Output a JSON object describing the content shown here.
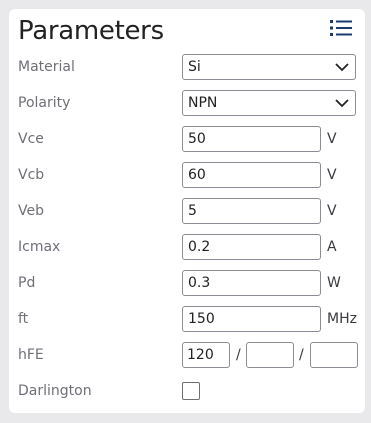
{
  "panel": {
    "title": "Parameters",
    "menu_icon": "list-icon"
  },
  "fields": {
    "material": {
      "label": "Material",
      "value": "Si"
    },
    "polarity": {
      "label": "Polarity",
      "value": "NPN"
    },
    "vce": {
      "label": "Vce",
      "value": "50",
      "unit": "V"
    },
    "vcb": {
      "label": "Vcb",
      "value": "60",
      "unit": "V"
    },
    "veb": {
      "label": "Veb",
      "value": "5",
      "unit": "V"
    },
    "icmax": {
      "label": "Icmax",
      "value": "0.2",
      "unit": "A"
    },
    "pd": {
      "label": "Pd",
      "value": "0.3",
      "unit": "W"
    },
    "ft": {
      "label": "ft",
      "value": "150",
      "unit": "MHz"
    },
    "hfe": {
      "label": "hFE",
      "min": "120",
      "typ": "",
      "max": "",
      "separator": "/"
    },
    "darlington": {
      "label": "Darlington",
      "checked": false
    }
  },
  "colors": {
    "background": "#e9e9ec",
    "panel": "#ffffff",
    "accent": "#1a3a6b",
    "label": "#6f6f78",
    "border": "#8c8c94"
  }
}
